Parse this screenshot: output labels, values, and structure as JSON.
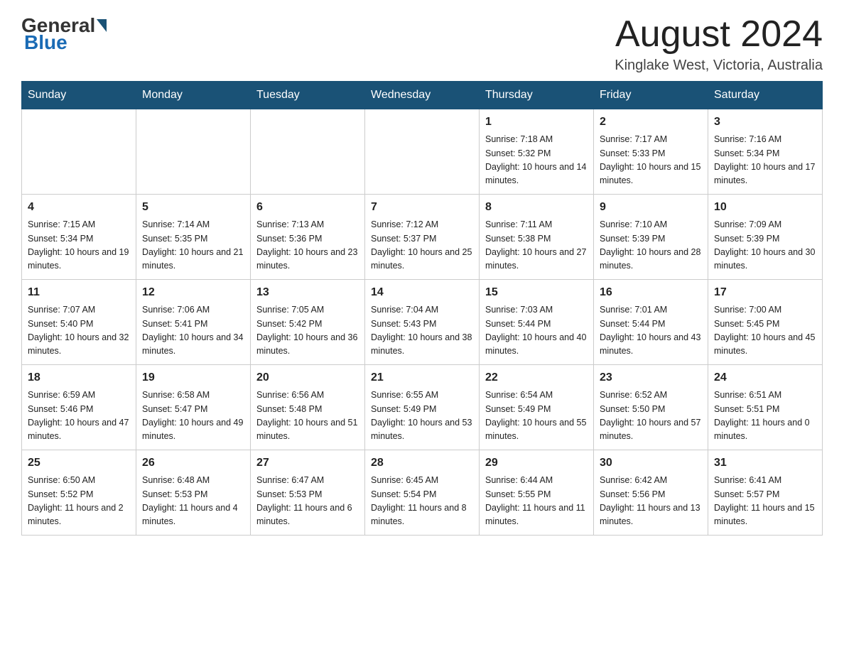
{
  "header": {
    "logo_general": "General",
    "logo_blue": "Blue",
    "month_title": "August 2024",
    "location": "Kinglake West, Victoria, Australia"
  },
  "days_of_week": [
    "Sunday",
    "Monday",
    "Tuesday",
    "Wednesday",
    "Thursday",
    "Friday",
    "Saturday"
  ],
  "weeks": [
    {
      "days": [
        {
          "number": "",
          "sunrise": "",
          "sunset": "",
          "daylight": ""
        },
        {
          "number": "",
          "sunrise": "",
          "sunset": "",
          "daylight": ""
        },
        {
          "number": "",
          "sunrise": "",
          "sunset": "",
          "daylight": ""
        },
        {
          "number": "",
          "sunrise": "",
          "sunset": "",
          "daylight": ""
        },
        {
          "number": "1",
          "sunrise": "Sunrise: 7:18 AM",
          "sunset": "Sunset: 5:32 PM",
          "daylight": "Daylight: 10 hours and 14 minutes."
        },
        {
          "number": "2",
          "sunrise": "Sunrise: 7:17 AM",
          "sunset": "Sunset: 5:33 PM",
          "daylight": "Daylight: 10 hours and 15 minutes."
        },
        {
          "number": "3",
          "sunrise": "Sunrise: 7:16 AM",
          "sunset": "Sunset: 5:34 PM",
          "daylight": "Daylight: 10 hours and 17 minutes."
        }
      ]
    },
    {
      "days": [
        {
          "number": "4",
          "sunrise": "Sunrise: 7:15 AM",
          "sunset": "Sunset: 5:34 PM",
          "daylight": "Daylight: 10 hours and 19 minutes."
        },
        {
          "number": "5",
          "sunrise": "Sunrise: 7:14 AM",
          "sunset": "Sunset: 5:35 PM",
          "daylight": "Daylight: 10 hours and 21 minutes."
        },
        {
          "number": "6",
          "sunrise": "Sunrise: 7:13 AM",
          "sunset": "Sunset: 5:36 PM",
          "daylight": "Daylight: 10 hours and 23 minutes."
        },
        {
          "number": "7",
          "sunrise": "Sunrise: 7:12 AM",
          "sunset": "Sunset: 5:37 PM",
          "daylight": "Daylight: 10 hours and 25 minutes."
        },
        {
          "number": "8",
          "sunrise": "Sunrise: 7:11 AM",
          "sunset": "Sunset: 5:38 PM",
          "daylight": "Daylight: 10 hours and 27 minutes."
        },
        {
          "number": "9",
          "sunrise": "Sunrise: 7:10 AM",
          "sunset": "Sunset: 5:39 PM",
          "daylight": "Daylight: 10 hours and 28 minutes."
        },
        {
          "number": "10",
          "sunrise": "Sunrise: 7:09 AM",
          "sunset": "Sunset: 5:39 PM",
          "daylight": "Daylight: 10 hours and 30 minutes."
        }
      ]
    },
    {
      "days": [
        {
          "number": "11",
          "sunrise": "Sunrise: 7:07 AM",
          "sunset": "Sunset: 5:40 PM",
          "daylight": "Daylight: 10 hours and 32 minutes."
        },
        {
          "number": "12",
          "sunrise": "Sunrise: 7:06 AM",
          "sunset": "Sunset: 5:41 PM",
          "daylight": "Daylight: 10 hours and 34 minutes."
        },
        {
          "number": "13",
          "sunrise": "Sunrise: 7:05 AM",
          "sunset": "Sunset: 5:42 PM",
          "daylight": "Daylight: 10 hours and 36 minutes."
        },
        {
          "number": "14",
          "sunrise": "Sunrise: 7:04 AM",
          "sunset": "Sunset: 5:43 PM",
          "daylight": "Daylight: 10 hours and 38 minutes."
        },
        {
          "number": "15",
          "sunrise": "Sunrise: 7:03 AM",
          "sunset": "Sunset: 5:44 PM",
          "daylight": "Daylight: 10 hours and 40 minutes."
        },
        {
          "number": "16",
          "sunrise": "Sunrise: 7:01 AM",
          "sunset": "Sunset: 5:44 PM",
          "daylight": "Daylight: 10 hours and 43 minutes."
        },
        {
          "number": "17",
          "sunrise": "Sunrise: 7:00 AM",
          "sunset": "Sunset: 5:45 PM",
          "daylight": "Daylight: 10 hours and 45 minutes."
        }
      ]
    },
    {
      "days": [
        {
          "number": "18",
          "sunrise": "Sunrise: 6:59 AM",
          "sunset": "Sunset: 5:46 PM",
          "daylight": "Daylight: 10 hours and 47 minutes."
        },
        {
          "number": "19",
          "sunrise": "Sunrise: 6:58 AM",
          "sunset": "Sunset: 5:47 PM",
          "daylight": "Daylight: 10 hours and 49 minutes."
        },
        {
          "number": "20",
          "sunrise": "Sunrise: 6:56 AM",
          "sunset": "Sunset: 5:48 PM",
          "daylight": "Daylight: 10 hours and 51 minutes."
        },
        {
          "number": "21",
          "sunrise": "Sunrise: 6:55 AM",
          "sunset": "Sunset: 5:49 PM",
          "daylight": "Daylight: 10 hours and 53 minutes."
        },
        {
          "number": "22",
          "sunrise": "Sunrise: 6:54 AM",
          "sunset": "Sunset: 5:49 PM",
          "daylight": "Daylight: 10 hours and 55 minutes."
        },
        {
          "number": "23",
          "sunrise": "Sunrise: 6:52 AM",
          "sunset": "Sunset: 5:50 PM",
          "daylight": "Daylight: 10 hours and 57 minutes."
        },
        {
          "number": "24",
          "sunrise": "Sunrise: 6:51 AM",
          "sunset": "Sunset: 5:51 PM",
          "daylight": "Daylight: 11 hours and 0 minutes."
        }
      ]
    },
    {
      "days": [
        {
          "number": "25",
          "sunrise": "Sunrise: 6:50 AM",
          "sunset": "Sunset: 5:52 PM",
          "daylight": "Daylight: 11 hours and 2 minutes."
        },
        {
          "number": "26",
          "sunrise": "Sunrise: 6:48 AM",
          "sunset": "Sunset: 5:53 PM",
          "daylight": "Daylight: 11 hours and 4 minutes."
        },
        {
          "number": "27",
          "sunrise": "Sunrise: 6:47 AM",
          "sunset": "Sunset: 5:53 PM",
          "daylight": "Daylight: 11 hours and 6 minutes."
        },
        {
          "number": "28",
          "sunrise": "Sunrise: 6:45 AM",
          "sunset": "Sunset: 5:54 PM",
          "daylight": "Daylight: 11 hours and 8 minutes."
        },
        {
          "number": "29",
          "sunrise": "Sunrise: 6:44 AM",
          "sunset": "Sunset: 5:55 PM",
          "daylight": "Daylight: 11 hours and 11 minutes."
        },
        {
          "number": "30",
          "sunrise": "Sunrise: 6:42 AM",
          "sunset": "Sunset: 5:56 PM",
          "daylight": "Daylight: 11 hours and 13 minutes."
        },
        {
          "number": "31",
          "sunrise": "Sunrise: 6:41 AM",
          "sunset": "Sunset: 5:57 PM",
          "daylight": "Daylight: 11 hours and 15 minutes."
        }
      ]
    }
  ]
}
